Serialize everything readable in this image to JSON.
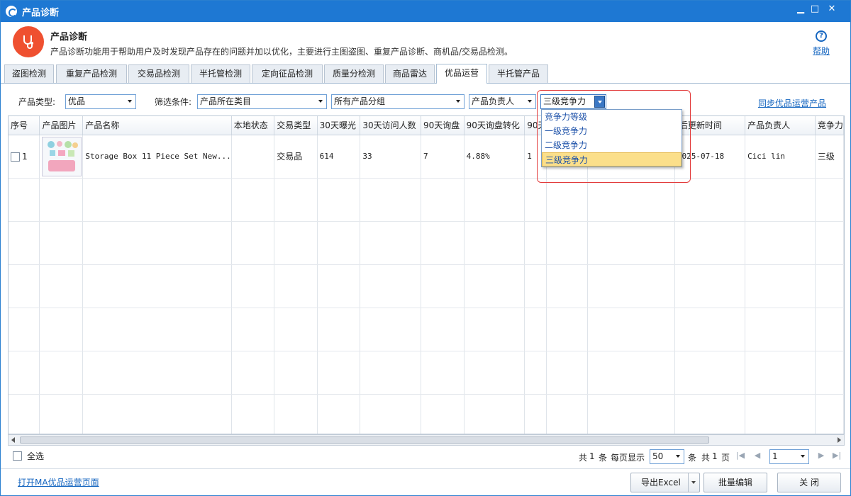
{
  "window": {
    "title": "产品诊断",
    "minimize": "▁",
    "maximize": "□",
    "close": "✕"
  },
  "header": {
    "title": "产品诊断",
    "description": "产品诊断功能用于帮助用户及时发现产品存在的问题并加以优化，主要进行主图盗图、重复产品诊断、商机品/交易品检测。",
    "help_icon": "?",
    "help_label": "帮助"
  },
  "tabs": [
    {
      "label": "盗图检测"
    },
    {
      "label": "重复产品检测"
    },
    {
      "label": "交易品检测"
    },
    {
      "label": "半托管检测"
    },
    {
      "label": "定向征品检测"
    },
    {
      "label": "质量分检测"
    },
    {
      "label": "商品雷达"
    },
    {
      "label": "优品运营"
    },
    {
      "label": "半托管产品"
    }
  ],
  "active_tab": "优品运营",
  "filters": {
    "product_type_label": "产品类型:",
    "product_type_value": "优品",
    "filter_label": "筛选条件:",
    "category_value": "产品所在类目",
    "group_value": "所有产品分组",
    "owner_value": "产品负责人",
    "competition_value": "三级竞争力",
    "sync_link": "同步优品运营产品"
  },
  "competition_dropdown": {
    "options": [
      "竞争力等级",
      "一级竞争力",
      "二级竞争力",
      "三级竞争力"
    ],
    "highlighted": "三级竞争力"
  },
  "table": {
    "columns": [
      "序号",
      "产品图片",
      "产品名称",
      "本地状态",
      "交易类型",
      "30天曝光",
      "30天访问人数",
      "90天询盘",
      "90天询盘转化",
      "90天",
      "",
      "",
      "最后更新时间",
      "产品负责人",
      "竞争力"
    ],
    "rows": [
      {
        "index": "1",
        "name": "Storage Box 11 Piece Set New...",
        "local_status": "",
        "trade_type": "交易品",
        "exposure_30d": "614",
        "visitors_30d": "33",
        "inquiries_90d": "7",
        "inquiry_conversion_90d": "4.88%",
        "col_90d": "1",
        "col_extra1": "",
        "col_extra2": "",
        "updated": "2025-07-18",
        "owner": "Cici lin",
        "competition": "三级"
      }
    ]
  },
  "footer": {
    "select_all": "全选",
    "total_prefix": "共",
    "total_count": "1",
    "total_suffix": "条",
    "per_page_label": "每页显示",
    "per_page_value": "50",
    "per_page_suffix": "条",
    "pages_prefix": "共",
    "pages_count": "1",
    "pages_suffix": "页",
    "first": "|◀",
    "prev": "◀",
    "page_value": "1",
    "next": "▶",
    "last": "▶|",
    "open_link": "打开MA优品运营页面",
    "export_label": "导出Excel",
    "batch_edit_label": "批量编辑",
    "close_label": "关 闭"
  },
  "colors": {
    "titlebar": "#1e78d3",
    "logo": "#ef5030",
    "link": "#1566c0",
    "highlight": "#fbdf8a",
    "annotation_box": "#e23a3a"
  }
}
